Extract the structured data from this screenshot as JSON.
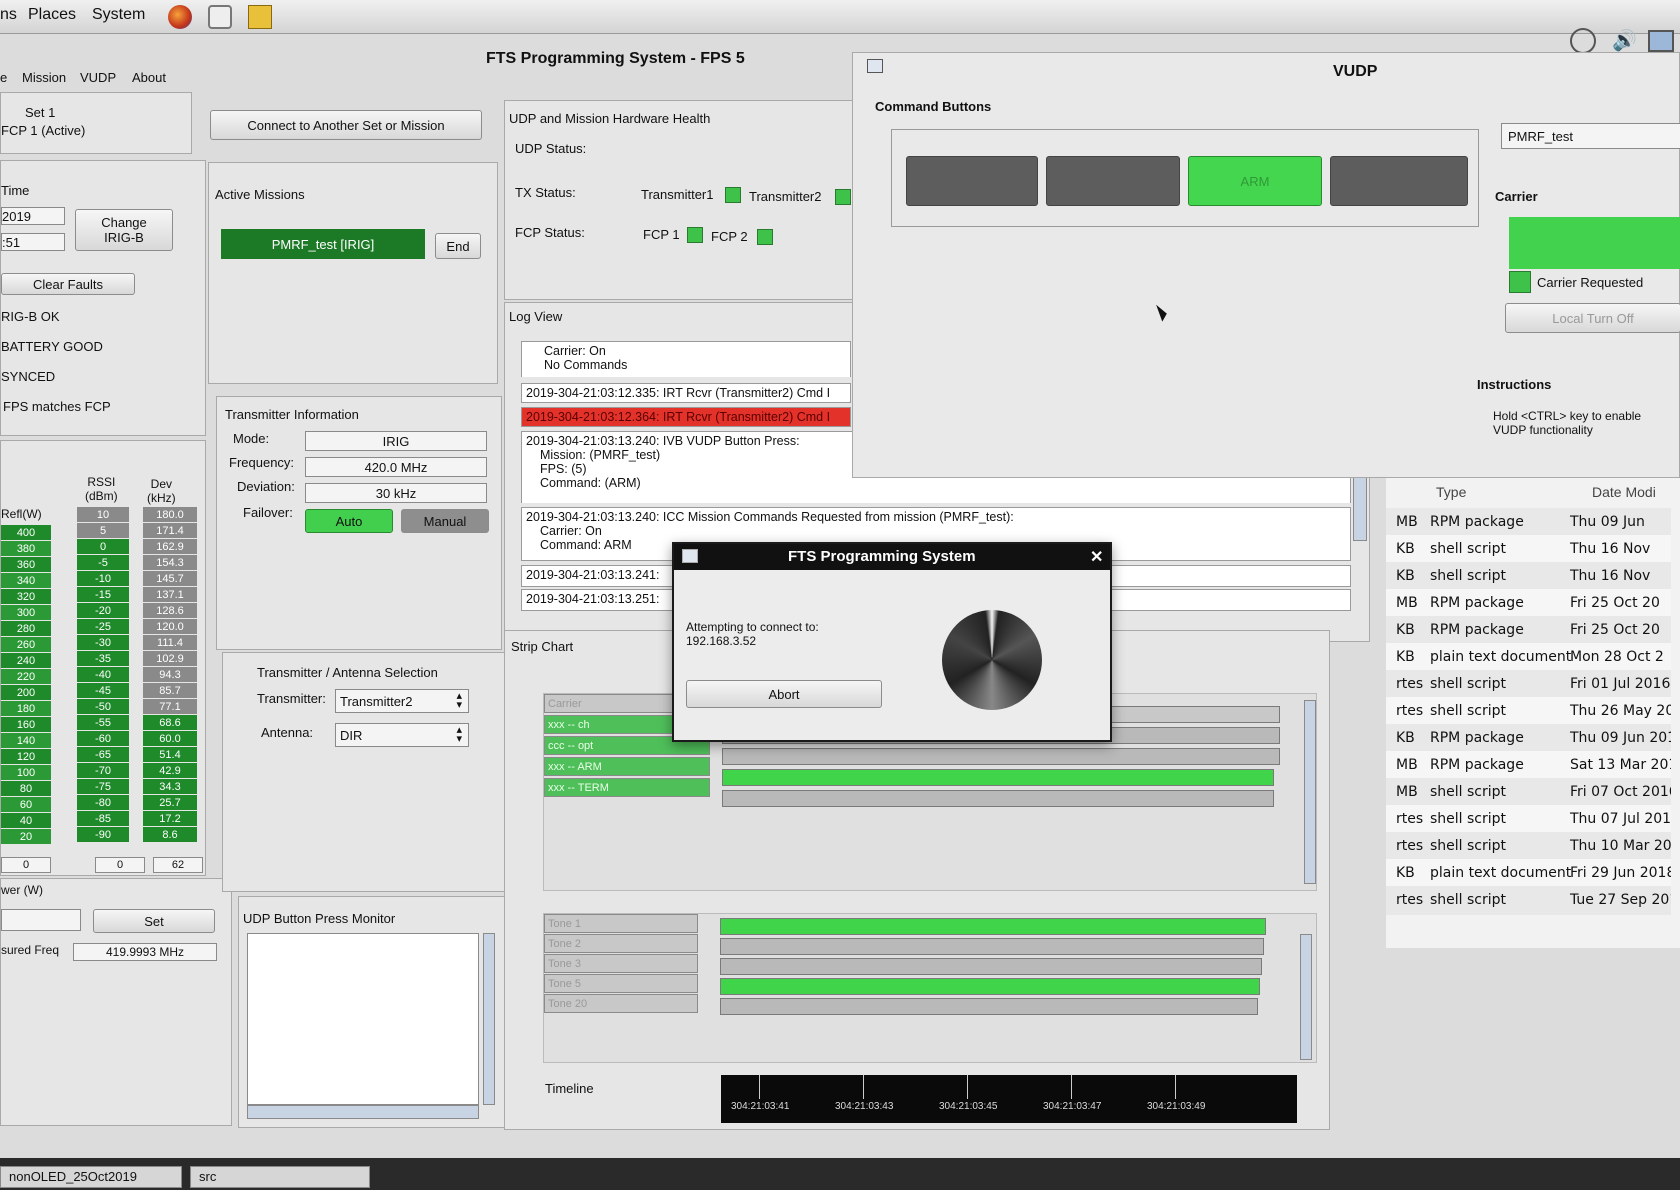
{
  "topbar": {
    "menu": [
      "ns",
      "Places",
      "System"
    ]
  },
  "window": {
    "title": "FTS Programming System - FPS 5",
    "menu": [
      "e",
      "Mission",
      "VUDP",
      "About"
    ]
  },
  "setinfo": {
    "line1": "Set 1",
    "line2": "FCP 1 (Active)"
  },
  "connect_button": "Connect to Another Set or Mission",
  "time": {
    "label": "Time",
    "value1": "2019",
    "value2": ":51",
    "change_button": "Change\nIRIG-B",
    "clear_faults": "Clear Faults"
  },
  "status_lines": [
    "RIG-B OK",
    "BATTERY GOOD",
    "SYNCED",
    "FPS matches FCP"
  ],
  "rssi": {
    "col_refl": "Refl(W)",
    "col_rssi": "RSSI\n(dBm)",
    "col_dev": "Dev\n(kHz)",
    "refl": [
      "400",
      "380",
      "360",
      "340",
      "320",
      "300",
      "280",
      "260",
      "240",
      "220",
      "200",
      "180",
      "160",
      "140",
      "120",
      "100",
      "80",
      "60",
      "40",
      "20"
    ],
    "rssi_vals": [
      "10",
      "5",
      "0",
      "-5",
      "-10",
      "-15",
      "-20",
      "-25",
      "-30",
      "-35",
      "-40",
      "-45",
      "-50",
      "-55",
      "-60",
      "-65",
      "-70",
      "-75",
      "-80",
      "-85",
      "-90"
    ],
    "dev_vals": [
      "180.0",
      "171.4",
      "162.9",
      "154.3",
      "145.7",
      "137.1",
      "128.6",
      "120.0",
      "111.4",
      "102.9",
      "94.3",
      "85.7",
      "77.1",
      "68.6",
      "60.0",
      "51.4",
      "42.9",
      "34.3",
      "25.7",
      "17.2",
      "8.6"
    ],
    "rssi_active": [
      "0",
      "-5",
      "-10",
      "-15",
      "-20",
      "-25",
      "-30",
      "-35",
      "-40",
      "-45",
      "-50",
      "-55",
      "-60",
      "-65",
      "-70",
      "-75",
      "-80",
      "-85",
      "-90"
    ],
    "readout_refl": "0",
    "readout_rssi": "0",
    "readout_dev": "62"
  },
  "power": {
    "label": "wer (W)",
    "set_button": "Set",
    "measured_label": "sured Freq",
    "measured_value": "419.9993 MHz"
  },
  "active_missions": {
    "title": "Active Missions",
    "mission": "PMRF_test [IRIG]",
    "end_button": "End"
  },
  "transmitter_info": {
    "title": "Transmitter Information",
    "mode_label": "Mode:",
    "mode": "IRIG",
    "freq_label": "Frequency:",
    "freq": "420.0 MHz",
    "dev_label": "Deviation:",
    "dev": "30 kHz",
    "failover_label": "Failover:",
    "auto": "Auto",
    "manual": "Manual"
  },
  "tx_antenna": {
    "title": "Transmitter / Antenna Selection",
    "tx_label": "Transmitter:",
    "tx_value": "Transmitter2",
    "ant_label": "Antenna:",
    "ant_value": "DIR"
  },
  "udp_monitor": {
    "title": "UDP Button Press Monitor"
  },
  "health": {
    "title": "UDP and Mission Hardware Health",
    "udp_status": "UDP Status:",
    "tx_status": "TX Status:",
    "tx1": "Transmitter1",
    "tx2": "Transmitter2",
    "fcp_status": "FCP Status:",
    "fcp1": "FCP 1",
    "fcp2": "FCP 2"
  },
  "log": {
    "title": "Log View",
    "entries": [
      "Carrier: On",
      "No Commands",
      "2019-304-21:03:12.335: IRT Rcvr  (Transmitter2) Cmd I",
      "2019-304-21:03:12.364: IRT Rcvr  (Transmitter2) Cmd I",
      "2019-304-21:03:13.240: IVB VUDP Button Press:",
      "Mission: (PMRF_test)",
      "FPS: (5)",
      "Command: (ARM)",
      "2019-304-21:03:13.240: ICC Mission Commands Requested from mission (PMRF_test):",
      "Carrier: On",
      "Command: ARM",
      "2019-304-21:03:13.241:",
      "2019-304-21:03:13.251:"
    ]
  },
  "strip": {
    "title": "Strip Chart",
    "cmd_labels": [
      "Carrier",
      "xxx -- ch",
      "ccc -- opt",
      "xxx -- ARM",
      "xxx -- TERM"
    ],
    "cmd_active": [
      false,
      true,
      true,
      true,
      true
    ],
    "tone_labels": [
      "Tone 1",
      "Tone 2",
      "Tone 3",
      "Tone 5",
      "Tone 20"
    ],
    "timeline_label": "Timeline",
    "timeline_ticks": [
      "304:21:03:41",
      "304:21:03:43",
      "304:21:03:45",
      "304:21:03:47",
      "304:21:03:49"
    ]
  },
  "vudp": {
    "title": "VUDP",
    "command_buttons": "Command Buttons",
    "buttons": [
      "",
      "",
      "ARM",
      ""
    ],
    "mission_field": "PMRF_test",
    "carrier_label": "Carrier",
    "carrier_requested": "Carrier Requested",
    "local_turn_off": "Local Turn Off",
    "instructions_title": "Instructions",
    "instructions_text": "Hold <CTRL> key to enable\nVUDP functionality"
  },
  "dialog": {
    "title": "FTS Programming System",
    "message": "Attempting to connect to:\n192.168.3.52",
    "abort": "Abort"
  },
  "file_list": {
    "col_type": "Type",
    "col_date": "Date Modi",
    "rows": [
      {
        "size": "MB",
        "type": "RPM package",
        "date": "Thu 09 Jun"
      },
      {
        "size": "KB",
        "type": "shell script",
        "date": "Thu 16 Nov"
      },
      {
        "size": "KB",
        "type": "shell script",
        "date": "Thu 16 Nov"
      },
      {
        "size": "MB",
        "type": "RPM package",
        "date": "Fri 25 Oct 20"
      },
      {
        "size": "KB",
        "type": "RPM package",
        "date": "Fri 25 Oct 20"
      },
      {
        "size": "KB",
        "type": "plain text document",
        "date": "Mon 28 Oct 2"
      },
      {
        "size": "rtes",
        "type": "shell script",
        "date": "Fri 01 Jul 2016"
      },
      {
        "size": "rtes",
        "type": "shell script",
        "date": "Thu 26 May 20"
      },
      {
        "size": "KB",
        "type": "RPM package",
        "date": "Thu 09 Jun 201"
      },
      {
        "size": "MB",
        "type": "RPM package",
        "date": "Sat 13 Mar 201"
      },
      {
        "size": "MB",
        "type": "shell script",
        "date": "Fri 07 Oct 2016"
      },
      {
        "size": "rtes",
        "type": "shell script",
        "date": "Thu 07 Jul 2016"
      },
      {
        "size": "rtes",
        "type": "shell script",
        "date": "Thu 10 Mar 2016"
      },
      {
        "size": "KB",
        "type": "plain text document",
        "date": "Fri 29 Jun 2018 0"
      },
      {
        "size": "rtes",
        "type": "shell script",
        "date": "Tue 27 Sep 2016"
      }
    ]
  },
  "taskbar": {
    "items": [
      "nonOLED_25Oct2019",
      "src"
    ]
  }
}
